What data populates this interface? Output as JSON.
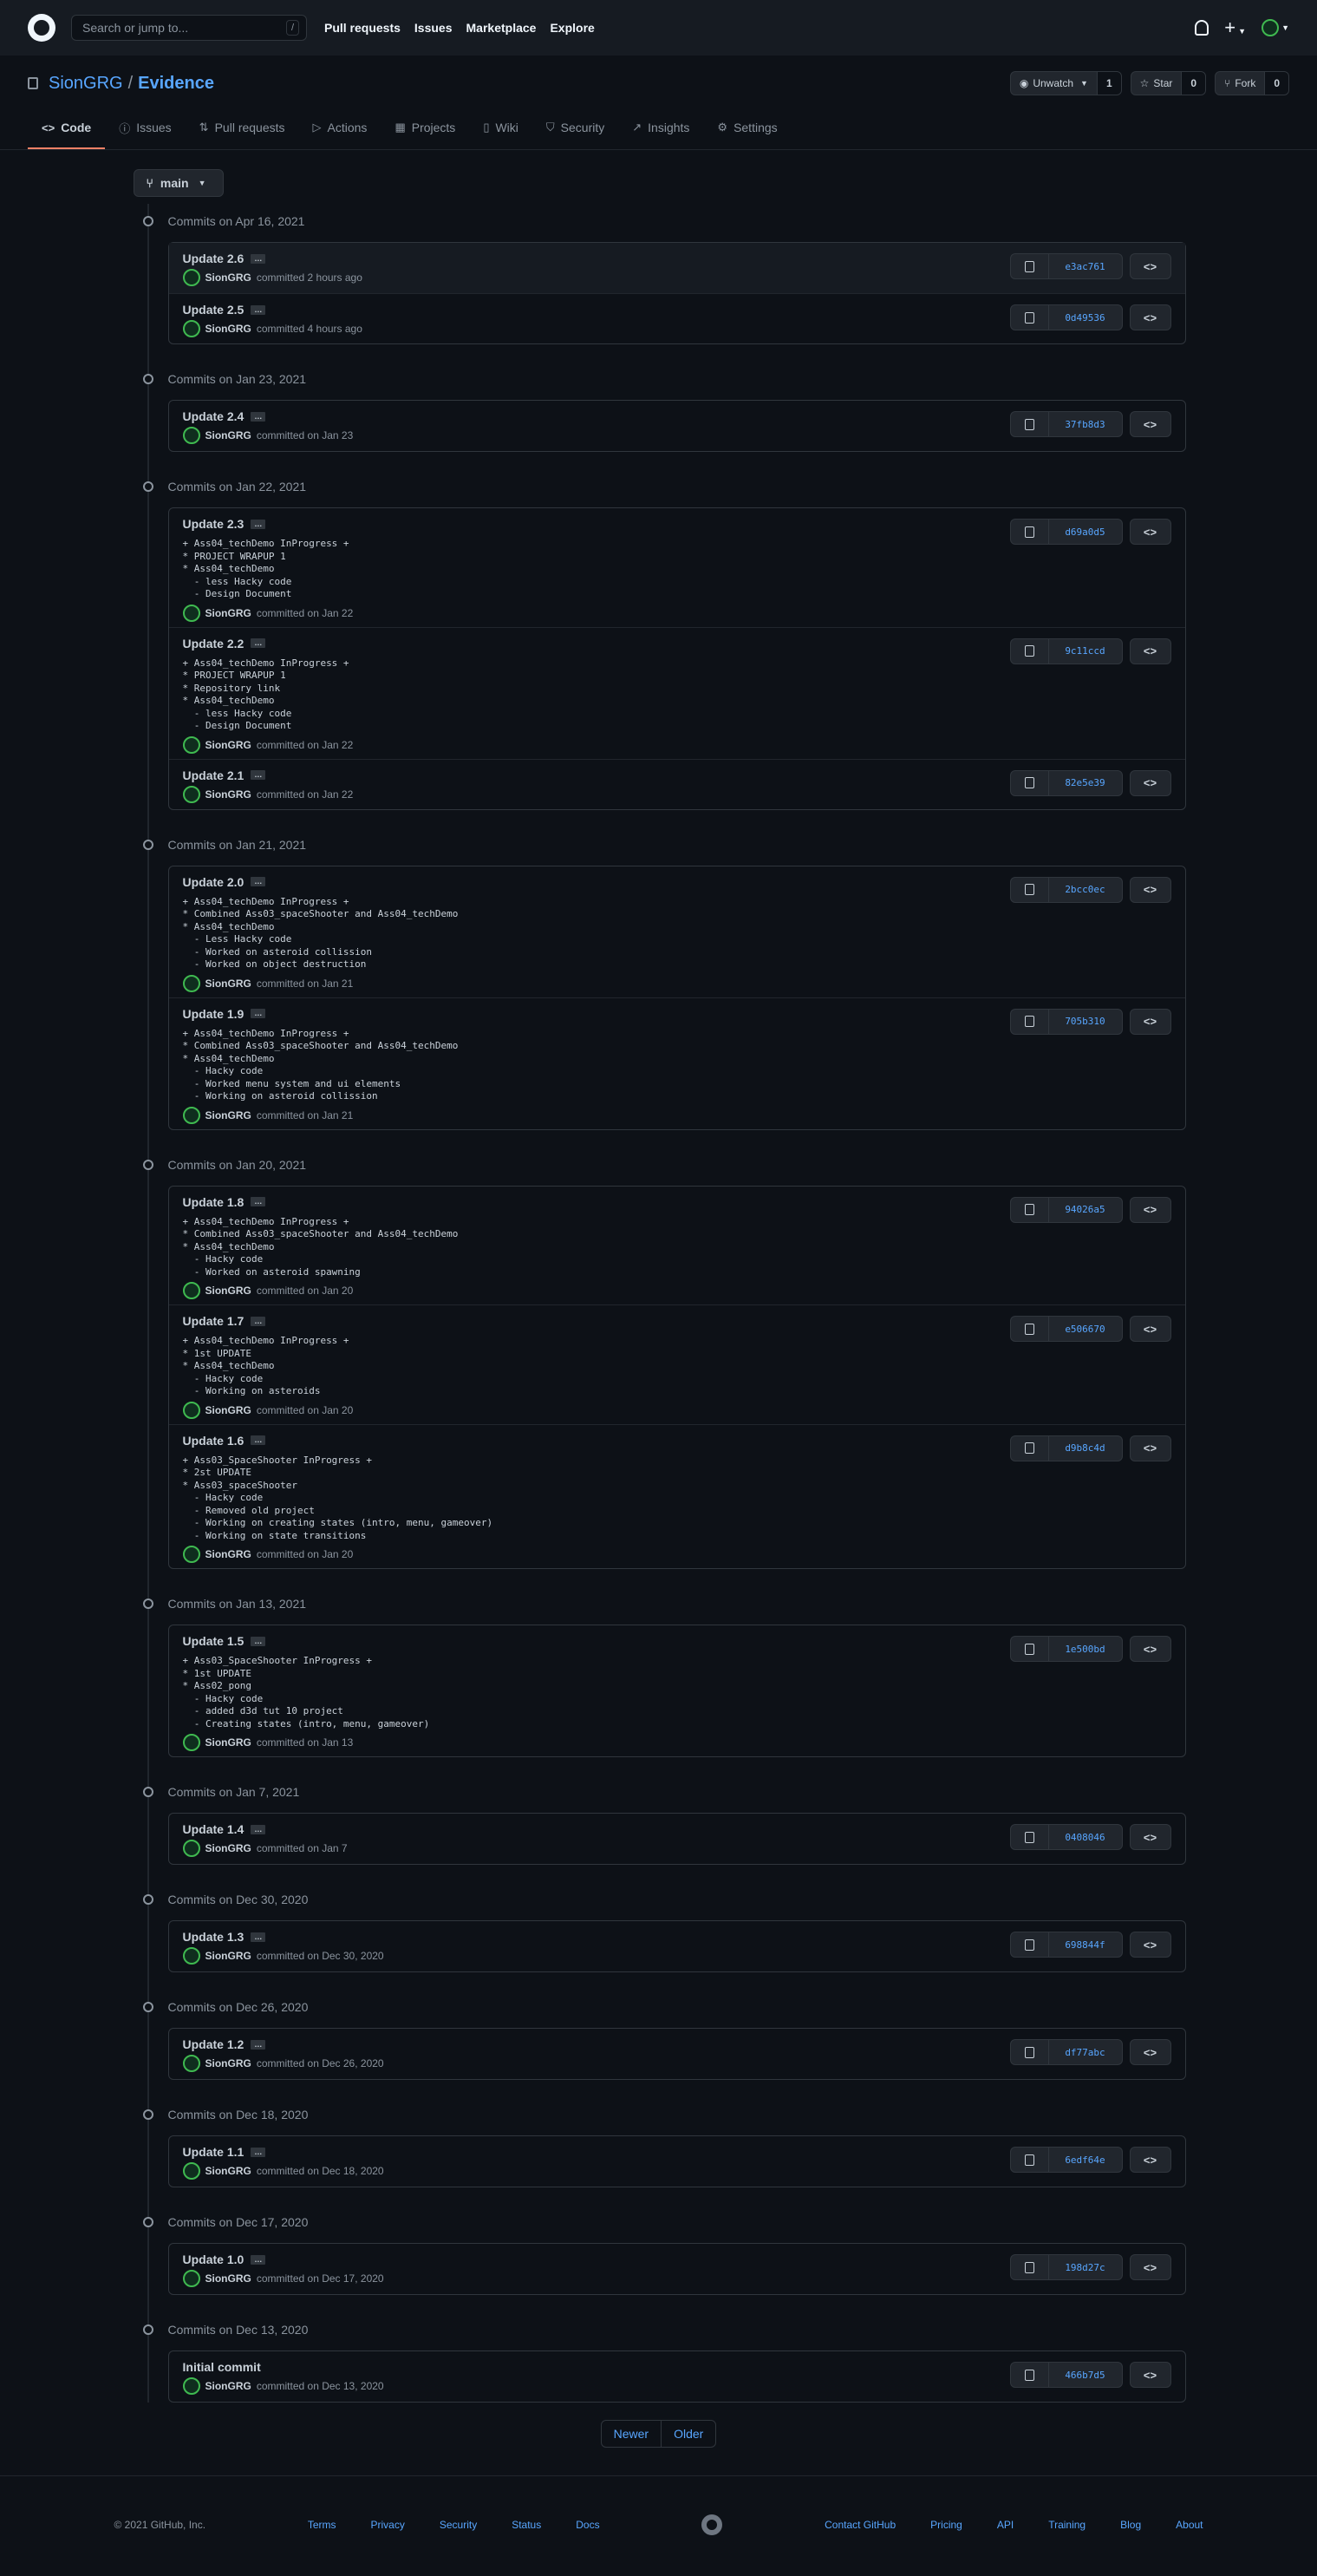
{
  "header": {
    "search_placeholder": "Search or jump to...",
    "search_key": "/",
    "nav": [
      "Pull requests",
      "Issues",
      "Marketplace",
      "Explore"
    ]
  },
  "repo": {
    "owner": "SionGRG",
    "separator": "/",
    "name": "Evidence",
    "watch_label": "Unwatch",
    "watch_count": "1",
    "star_label": "Star",
    "star_count": "0",
    "fork_label": "Fork",
    "fork_count": "0"
  },
  "tabs": [
    {
      "label": "Code",
      "icon": "code-icon",
      "glyph": "<>"
    },
    {
      "label": "Issues",
      "icon": "issue-icon",
      "glyph": "ⓘ"
    },
    {
      "label": "Pull requests",
      "icon": "pull-request-icon",
      "glyph": "⇅"
    },
    {
      "label": "Actions",
      "icon": "play-icon",
      "glyph": "▷"
    },
    {
      "label": "Projects",
      "icon": "project-icon",
      "glyph": "▦"
    },
    {
      "label": "Wiki",
      "icon": "book-icon",
      "glyph": "▯"
    },
    {
      "label": "Security",
      "icon": "shield-icon",
      "glyph": "⛉"
    },
    {
      "label": "Insights",
      "icon": "graph-icon",
      "glyph": "↗"
    },
    {
      "label": "Settings",
      "icon": "gear-icon",
      "glyph": "⚙"
    }
  ],
  "branch": "main",
  "groups": [
    {
      "date": "Commits on Apr 16, 2021",
      "commits": [
        {
          "title": "Update 2.6",
          "body": "",
          "author": "SionGRG",
          "time": "committed 2 hours ago",
          "sha": "e3ac761"
        },
        {
          "title": "Update 2.5",
          "body": "",
          "author": "SionGRG",
          "time": "committed 4 hours ago",
          "sha": "0d49536"
        }
      ]
    },
    {
      "date": "Commits on Jan 23, 2021",
      "commits": [
        {
          "title": "Update 2.4",
          "body": "",
          "author": "SionGRG",
          "time": "committed on Jan 23",
          "sha": "37fb8d3"
        }
      ]
    },
    {
      "date": "Commits on Jan 22, 2021",
      "commits": [
        {
          "title": "Update 2.3",
          "body": "+ Ass04_techDemo InProgress +\n* PROJECT WRAPUP 1\n* Ass04_techDemo\n  - less Hacky code\n  - Design Document",
          "author": "SionGRG",
          "time": "committed on Jan 22",
          "sha": "d69a0d5"
        },
        {
          "title": "Update 2.2",
          "body": "+ Ass04_techDemo InProgress +\n* PROJECT WRAPUP 1\n* Repository link\n* Ass04_techDemo\n  - less Hacky code\n  - Design Document",
          "author": "SionGRG",
          "time": "committed on Jan 22",
          "sha": "9c11ccd"
        },
        {
          "title": "Update 2.1",
          "body": "",
          "author": "SionGRG",
          "time": "committed on Jan 22",
          "sha": "82e5e39"
        }
      ]
    },
    {
      "date": "Commits on Jan 21, 2021",
      "commits": [
        {
          "title": "Update 2.0",
          "body": "+ Ass04_techDemo InProgress +\n* Combined Ass03_spaceShooter and Ass04_techDemo\n* Ass04_techDemo\n  - Less Hacky code\n  - Worked on asteroid collission\n  - Worked on object destruction",
          "author": "SionGRG",
          "time": "committed on Jan 21",
          "sha": "2bcc0ec"
        },
        {
          "title": "Update 1.9",
          "body": "+ Ass04_techDemo InProgress +\n* Combined Ass03_spaceShooter and Ass04_techDemo\n* Ass04_techDemo\n  - Hacky code\n  - Worked menu system and ui elements\n  - Working on asteroid collission",
          "author": "SionGRG",
          "time": "committed on Jan 21",
          "sha": "705b310"
        }
      ]
    },
    {
      "date": "Commits on Jan 20, 2021",
      "commits": [
        {
          "title": "Update 1.8",
          "body": "+ Ass04_techDemo InProgress +\n* Combined Ass03_spaceShooter and Ass04_techDemo\n* Ass04_techDemo\n  - Hacky code\n  - Worked on asteroid spawning",
          "author": "SionGRG",
          "time": "committed on Jan 20",
          "sha": "94026a5"
        },
        {
          "title": "Update 1.7",
          "body": "+ Ass04_techDemo InProgress +\n* 1st UPDATE\n* Ass04_techDemo\n  - Hacky code\n  - Working on asteroids",
          "author": "SionGRG",
          "time": "committed on Jan 20",
          "sha": "e506670"
        },
        {
          "title": "Update 1.6",
          "body": "+ Ass03_SpaceShooter InProgress +\n* 2st UPDATE\n* Ass03_spaceShooter\n  - Hacky code\n  - Removed old project\n  - Working on creating states (intro, menu, gameover)\n  - Working on state transitions",
          "author": "SionGRG",
          "time": "committed on Jan 20",
          "sha": "d9b8c4d"
        }
      ]
    },
    {
      "date": "Commits on Jan 13, 2021",
      "commits": [
        {
          "title": "Update 1.5",
          "body": "+ Ass03_SpaceShooter InProgress +\n* 1st UPDATE\n* Ass02_pong\n  - Hacky code\n  - added d3d tut 10 project\n  - Creating states (intro, menu, gameover)",
          "author": "SionGRG",
          "time": "committed on Jan 13",
          "sha": "1e500bd"
        }
      ]
    },
    {
      "date": "Commits on Jan 7, 2021",
      "commits": [
        {
          "title": "Update 1.4",
          "body": "",
          "author": "SionGRG",
          "time": "committed on Jan 7",
          "sha": "0408046"
        }
      ]
    },
    {
      "date": "Commits on Dec 30, 2020",
      "commits": [
        {
          "title": "Update 1.3",
          "body": "",
          "author": "SionGRG",
          "time": "committed on Dec 30, 2020",
          "sha": "698844f"
        }
      ]
    },
    {
      "date": "Commits on Dec 26, 2020",
      "commits": [
        {
          "title": "Update 1.2",
          "body": "",
          "author": "SionGRG",
          "time": "committed on Dec 26, 2020",
          "sha": "df77abc"
        }
      ]
    },
    {
      "date": "Commits on Dec 18, 2020",
      "commits": [
        {
          "title": "Update 1.1",
          "body": "",
          "author": "SionGRG",
          "time": "committed on Dec 18, 2020",
          "sha": "6edf64e"
        }
      ]
    },
    {
      "date": "Commits on Dec 17, 2020",
      "commits": [
        {
          "title": "Update 1.0",
          "body": "",
          "author": "SionGRG",
          "time": "committed on Dec 17, 2020",
          "sha": "198d27c"
        }
      ]
    },
    {
      "date": "Commits on Dec 13, 2020",
      "commits": [
        {
          "title": "Initial commit",
          "body": "",
          "author": "SionGRG",
          "time": "committed on Dec 13, 2020",
          "sha": "466b7d5",
          "no_ellipsis": true
        }
      ]
    }
  ],
  "pagination": {
    "newer": "Newer",
    "older": "Older"
  },
  "footer": {
    "copyright": "© 2021 GitHub, Inc.",
    "left_links": [
      "Terms",
      "Privacy",
      "Security",
      "Status",
      "Docs"
    ],
    "right_links": [
      "Contact GitHub",
      "Pricing",
      "API",
      "Training",
      "Blog",
      "About"
    ]
  },
  "colors": {
    "accent": "#58a6ff",
    "tab_underline": "#f78166",
    "background": "#0d1117"
  }
}
